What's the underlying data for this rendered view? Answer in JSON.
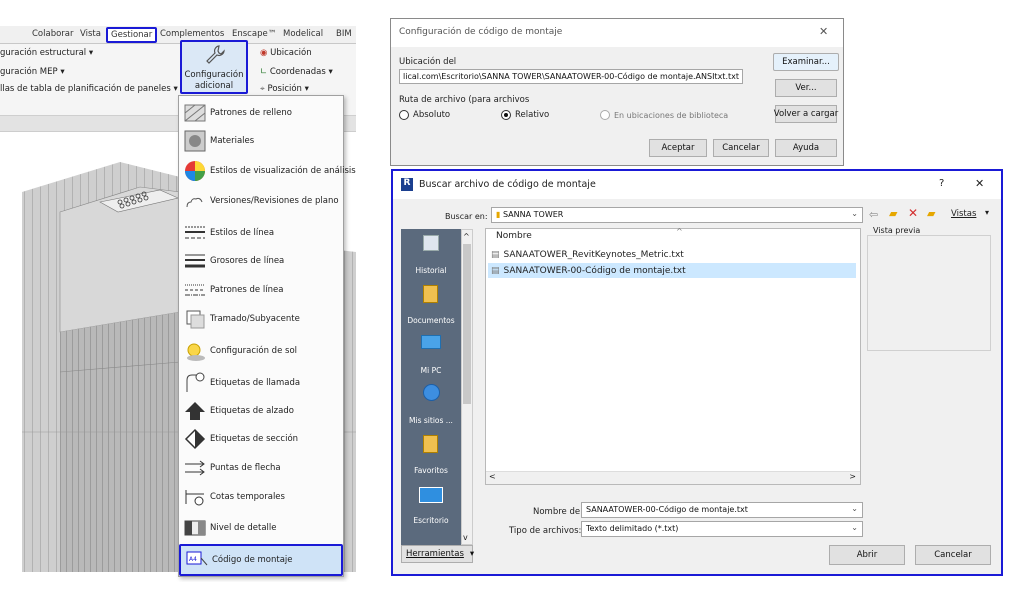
{
  "ribbon": {
    "tabs": [
      "Colaborar",
      "Vista",
      "Gestionar",
      "Complementos",
      "Enscape™",
      "Modelical",
      "BIM"
    ],
    "left_items": [
      "guración estructural ▾",
      "guración MEP ▾",
      "llas de tabla de planificación de paneles ▾"
    ],
    "config_button": "Configuración adicional",
    "config_line1": "Configuración",
    "config_line2": "adicional",
    "right_items": [
      "Ubicación",
      "Coordenadas ▾",
      "Posición ▾"
    ]
  },
  "dropdown": {
    "items": [
      "Patrones de relleno",
      "Materiales",
      "Estilos de visualización de análisis",
      "Versiones/Revisiones de plano",
      "Estilos de línea",
      "Grosores de línea",
      "Patrones de línea",
      "Tramado/Subyacente",
      "Configuración de sol",
      "Etiquetas de llamada",
      "Etiquetas de alzado",
      "Etiquetas de sección",
      "Puntas de flecha",
      "Cotas temporales",
      "Nivel de detalle",
      "Código de montaje"
    ]
  },
  "config_dialog": {
    "title": "Configuración de código de montaje",
    "location_label": "Ubicación del",
    "path_value": "lical.com\\Escritorio\\SANNA TOWER\\SANAATOWER-00-Código de montaje.ANSItxt.txt",
    "route_label": "Ruta de archivo (para archivos",
    "radio_absolute": "Absoluto",
    "radio_relative": "Relativo",
    "radio_library": "En ubicaciones de biblioteca",
    "btn_browse": "Examinar...",
    "btn_view": "Ver...",
    "btn_reload": "Volver a cargar",
    "btn_accept": "Aceptar",
    "btn_cancel": "Cancelar",
    "btn_help": "Ayuda",
    "close": "✕"
  },
  "file_dialog": {
    "title": "Buscar archivo de código de montaje",
    "help": "?",
    "close": "✕",
    "look_in_label": "Buscar en:",
    "look_in_value": "SANNA TOWER",
    "views_label": "Vistas",
    "preview_label": "Vista previa",
    "column_name": "Nombre",
    "files": [
      "SANAATOWER_RevitKeynotes_Metric.txt",
      "SANAATOWER-00-Código de montaje.txt"
    ],
    "places": [
      "Historial",
      "Documentos",
      "Mi PC",
      "Mis sitios ...",
      "Favoritos",
      "Escritorio"
    ],
    "filename_label": "Nombre de",
    "filename_value": "SANAATOWER-00-Código de montaje.txt",
    "filetype_label": "Tipo de archivos:",
    "filetype_value": "Texto delimitado (*.txt)",
    "tools_label": "Herramientas",
    "btn_open": "Abrir",
    "btn_cancel": "Cancelar"
  },
  "colors": {
    "highlight": "#1a1ad6",
    "selection": "#cce8ff",
    "places_bg": "#5b6a7d"
  }
}
